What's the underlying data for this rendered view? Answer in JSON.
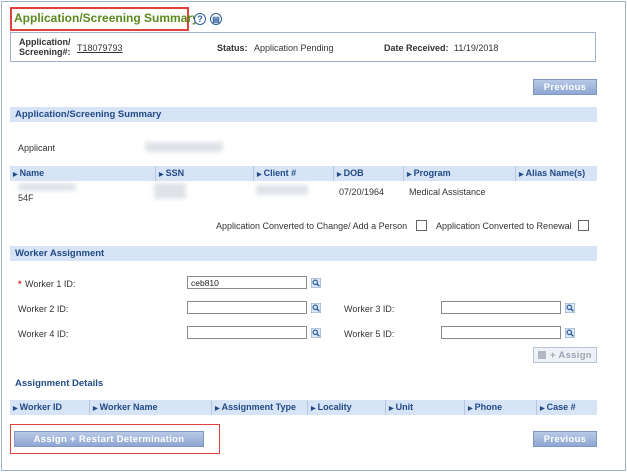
{
  "header": {
    "title": "Application/Screening Summary",
    "help_icon": "help-icon",
    "doc_icon": "document-icon"
  },
  "info": {
    "app_label_line1": "Application/",
    "app_label_line2": "Screening#:",
    "app_number": "T18079793",
    "status_label": "Status:",
    "status_value": "Application Pending",
    "date_label": "Date Received:",
    "date_value": "11/19/2018"
  },
  "buttons": {
    "previous_top": "Previous",
    "previous_bottom": "Previous",
    "assign": "+ Assign",
    "assign_restart": "Assign + Restart Determination"
  },
  "summary": {
    "section_title": "Application/Screening Summary",
    "applicant_label": "Applicant",
    "columns": [
      "Name",
      "SSN",
      "Client #",
      "DOB",
      "Program",
      "Alias Name(s)"
    ],
    "row": {
      "name_suffix": "54F",
      "dob": "07/20/1964",
      "program": "Medical Assistance"
    },
    "converted_change_label": "Application Converted to Change/ Add a Person",
    "converted_renewal_label": "Application Converted to Renewal"
  },
  "worker": {
    "section_title": "Worker Assignment",
    "required_mark": "*",
    "worker1_label": "Worker 1 ID:",
    "worker1_value": "ceb810",
    "worker2_label": "Worker 2 ID:",
    "worker3_label": "Worker 3 ID:",
    "worker4_label": "Worker 4 ID:",
    "worker5_label": "Worker 5 ID:"
  },
  "details": {
    "section_title": "Assignment Details",
    "columns": [
      "Worker ID",
      "Worker Name",
      "Assignment Type",
      "Locality",
      "Unit",
      "Phone",
      "Case #"
    ]
  },
  "colors": {
    "title_green": "#5a8a1c",
    "section_blue": "#d7e4f5",
    "highlight_red": "#e0423b",
    "button_blue": "#8ea6d2"
  }
}
